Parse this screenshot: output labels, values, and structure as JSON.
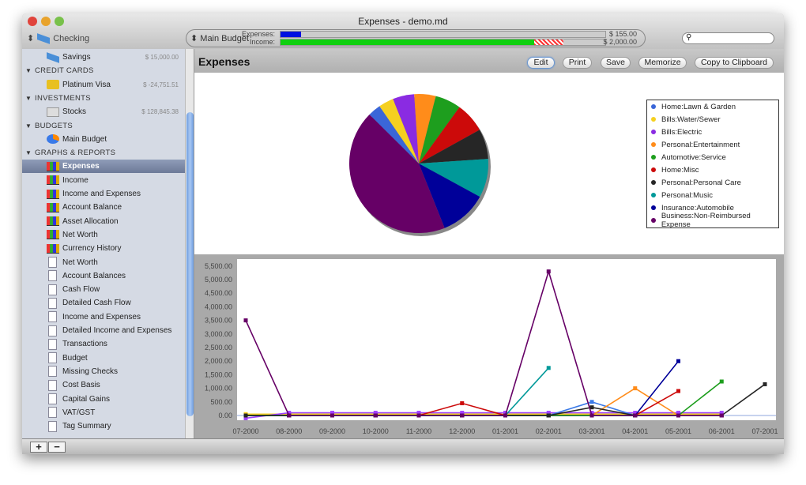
{
  "window": {
    "title": "Expenses - demo.md"
  },
  "toolbar": {
    "account": "Checking",
    "budget": "Main Budget",
    "expenses_label": "Expenses:",
    "income_label": "Income:",
    "expenses_amount": "$ 155.00",
    "income_amount": "$ 2,000.00",
    "expenses_progress": 0.064,
    "income_progress": 0.78,
    "income_over_progress": 0.09,
    "search_placeholder": ""
  },
  "sidebar": {
    "rows": [
      {
        "type": "item",
        "label": "Savings",
        "amount": "$ 15,000.00",
        "icon": "bank-card-icon"
      },
      {
        "type": "header",
        "label": "CREDIT CARDS"
      },
      {
        "type": "item",
        "label": "Platinum Visa",
        "amount": "$ -24,751.51",
        "icon": "credit-card-icon"
      },
      {
        "type": "header",
        "label": "INVESTMENTS"
      },
      {
        "type": "item",
        "label": "Stocks",
        "amount": "$ 128,845.38",
        "icon": "stocks-icon"
      },
      {
        "type": "header",
        "label": "BUDGETS"
      },
      {
        "type": "item",
        "label": "Main Budget",
        "amount": "",
        "icon": "budget-pie-icon"
      },
      {
        "type": "header",
        "label": "GRAPHS & REPORTS"
      },
      {
        "type": "graph",
        "label": "Expenses",
        "selected": true
      },
      {
        "type": "graph",
        "label": "Income"
      },
      {
        "type": "graph",
        "label": "Income and Expenses"
      },
      {
        "type": "graph",
        "label": "Account Balance"
      },
      {
        "type": "graph",
        "label": "Asset Allocation"
      },
      {
        "type": "graph",
        "label": "Net Worth"
      },
      {
        "type": "graph",
        "label": "Currency History"
      },
      {
        "type": "report",
        "label": "Net Worth"
      },
      {
        "type": "report",
        "label": "Account Balances"
      },
      {
        "type": "report",
        "label": "Cash Flow"
      },
      {
        "type": "report",
        "label": "Detailed Cash Flow"
      },
      {
        "type": "report",
        "label": "Income and Expenses"
      },
      {
        "type": "report",
        "label": "Detailed Income and Expenses"
      },
      {
        "type": "report",
        "label": "Transactions"
      },
      {
        "type": "report",
        "label": "Budget"
      },
      {
        "type": "report",
        "label": "Missing Checks"
      },
      {
        "type": "report",
        "label": "Cost Basis"
      },
      {
        "type": "report",
        "label": "Capital Gains"
      },
      {
        "type": "report",
        "label": "VAT/GST"
      },
      {
        "type": "report",
        "label": "Tag Summary"
      }
    ],
    "add": "+",
    "remove": "−"
  },
  "main": {
    "title": "Expenses",
    "buttons": [
      "Edit",
      "Print",
      "Save",
      "Memorize",
      "Copy to Clipboard"
    ]
  },
  "chart_data": [
    {
      "type": "pie",
      "series": [
        {
          "name": "Home:Lawn & Garden",
          "value": 3,
          "color": "#3a66d8"
        },
        {
          "name": "Bills:Water/Sewer",
          "value": 3.5,
          "color": "#f5d020"
        },
        {
          "name": "Bills:Electric",
          "value": 5,
          "color": "#8a2be2"
        },
        {
          "name": "Personal:Entertainment",
          "value": 5,
          "color": "#ff8c1a"
        },
        {
          "name": "Automotive:Service",
          "value": 6,
          "color": "#1e9e1e"
        },
        {
          "name": "Home:Misc",
          "value": 7,
          "color": "#cc0a0a"
        },
        {
          "name": "Personal:Personal Care",
          "value": 7,
          "color": "#262626"
        },
        {
          "name": "Personal:Music",
          "value": 9,
          "color": "#009999"
        },
        {
          "name": "Insurance:Automobile",
          "value": 11,
          "color": "#000099"
        },
        {
          "name": "Business:Non-Reimbursed Expense",
          "value": 43.5,
          "color": "#660066"
        }
      ]
    },
    {
      "type": "line",
      "categories": [
        "07-2000",
        "08-2000",
        "09-2000",
        "10-2000",
        "11-2000",
        "12-2000",
        "01-2001",
        "02-2001",
        "03-2001",
        "04-2001",
        "05-2001",
        "06-2001",
        "07-2001"
      ],
      "ylim": [
        -250,
        5600
      ],
      "yticks": [
        "0.00",
        "500.00",
        "1,000.00",
        "1,500.00",
        "2,000.00",
        "2,500.00",
        "3,000.00",
        "3,500.00",
        "4,000.00",
        "4,500.00",
        "5,000.00",
        "5,500.00"
      ],
      "series": [
        {
          "name": "Bills:Water/Sewer",
          "color": "#f5d020",
          "values": [
            50,
            50,
            50,
            50,
            50,
            50,
            50,
            50,
            50,
            50,
            50,
            50,
            null
          ]
        },
        {
          "name": "Bills:Electric",
          "color": "#a040ff",
          "values": [
            -100,
            100,
            100,
            100,
            100,
            100,
            100,
            100,
            100,
            100,
            100,
            100,
            null
          ]
        },
        {
          "name": "Home:Lawn & Garden",
          "color": "#3a7ae8",
          "values": [
            0,
            0,
            0,
            0,
            0,
            0,
            0,
            0,
            500,
            0,
            0,
            0,
            null
          ]
        },
        {
          "name": "Personal:Entertainment",
          "color": "#ff8c1a",
          "values": [
            0,
            0,
            0,
            0,
            0,
            0,
            0,
            0,
            0,
            1000,
            0,
            0,
            null
          ]
        },
        {
          "name": "Home:Misc",
          "color": "#cc0a0a",
          "values": [
            0,
            0,
            0,
            0,
            0,
            450,
            0,
            0,
            0,
            0,
            900,
            null,
            null
          ]
        },
        {
          "name": "Personal:Music",
          "color": "#009999",
          "values": [
            0,
            0,
            0,
            0,
            0,
            0,
            0,
            1750,
            null,
            null,
            null,
            null,
            null
          ]
        },
        {
          "name": "Insurance:Automobile",
          "color": "#000099",
          "values": [
            0,
            0,
            0,
            0,
            0,
            0,
            0,
            0,
            0,
            0,
            2000,
            null,
            null
          ]
        },
        {
          "name": "Automotive:Service",
          "color": "#1e9e1e",
          "values": [
            0,
            0,
            0,
            0,
            0,
            0,
            0,
            0,
            0,
            0,
            0,
            1250,
            null
          ]
        },
        {
          "name": "Personal:Personal Care",
          "color": "#262626",
          "values": [
            0,
            0,
            0,
            0,
            0,
            0,
            0,
            0,
            300,
            0,
            0,
            0,
            1150
          ]
        },
        {
          "name": "Business:Non-Reimbursed Expense",
          "color": "#660066",
          "values": [
            3500,
            0,
            0,
            0,
            0,
            0,
            0,
            5300,
            0,
            0,
            0,
            0,
            null
          ]
        }
      ]
    }
  ]
}
